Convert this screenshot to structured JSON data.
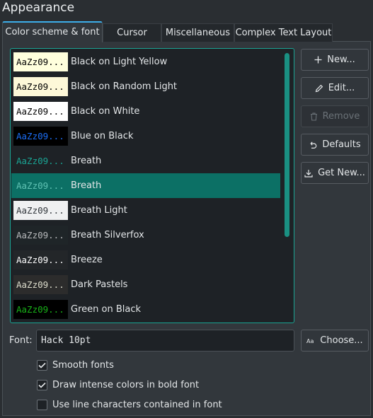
{
  "section_title": "Appearance",
  "tabs": [
    {
      "label": "Color scheme & font",
      "active": true
    },
    {
      "label": "Cursor",
      "active": false
    },
    {
      "label": "Miscellaneous",
      "active": false
    },
    {
      "label": "Complex Text Layout",
      "active": false
    }
  ],
  "schemes": [
    {
      "name": "Black on Light Yellow",
      "preview": "AaZz09...",
      "bg": "#ffffdd",
      "fg": "#000000",
      "selected": false
    },
    {
      "name": "Black on Random Light",
      "preview": "AaZz09...",
      "bg": "#fdf8d8",
      "fg": "#000000",
      "selected": false
    },
    {
      "name": "Black on White",
      "preview": "AaZz09...",
      "bg": "#ffffff",
      "fg": "#000000",
      "selected": false
    },
    {
      "name": "Blue on Black",
      "preview": "AaZz09...",
      "bg": "#000000",
      "fg": "#1c6ef5",
      "selected": false
    },
    {
      "name": "Breath",
      "preview": "AaZz09...",
      "bg": "#1e2226",
      "fg": "#1aa393",
      "selected": false
    },
    {
      "name": "Breath",
      "preview": "AaZz09...",
      "bg": "#0c7065",
      "fg": "#5fc2b3",
      "selected": true
    },
    {
      "name": "Breath Light",
      "preview": "AaZz09...",
      "bg": "#eff0f1",
      "fg": "#31363b",
      "selected": false
    },
    {
      "name": "Breath Silverfox",
      "preview": "AaZz09...",
      "bg": "#1f2528",
      "fg": "#b7b9bb",
      "selected": false
    },
    {
      "name": "Breeze",
      "preview": "AaZz09...",
      "bg": "#232629",
      "fg": "#fcfcfc",
      "selected": false
    },
    {
      "name": "Dark Pastels",
      "preview": "AaZz09...",
      "bg": "#2c2c2c",
      "fg": "#dcdccc",
      "selected": false
    },
    {
      "name": "Green on Black",
      "preview": "AaZz09...",
      "bg": "#000000",
      "fg": "#18b218",
      "selected": false
    }
  ],
  "buttons": {
    "new": "New...",
    "edit": "Edit...",
    "remove": "Remove",
    "defaults": "Defaults",
    "get_new": "Get New...",
    "choose": "Choose..."
  },
  "font": {
    "label": "Font:",
    "value": "Hack 10pt"
  },
  "checkboxes": [
    {
      "label": "Smooth fonts",
      "checked": true
    },
    {
      "label": "Draw intense colors in bold font",
      "checked": true
    },
    {
      "label": "Use line characters contained in font",
      "checked": false
    }
  ],
  "colors": {
    "accent": "#1aa393",
    "selection": "#0c7065",
    "window_bg": "#2a2e32",
    "view_bg": "#1e2226"
  },
  "icons": {
    "new": "plus-icon",
    "edit": "pencil-icon",
    "remove": "trash-icon",
    "defaults": "undo-icon",
    "get_new": "download-icon",
    "choose": "font-icon"
  }
}
